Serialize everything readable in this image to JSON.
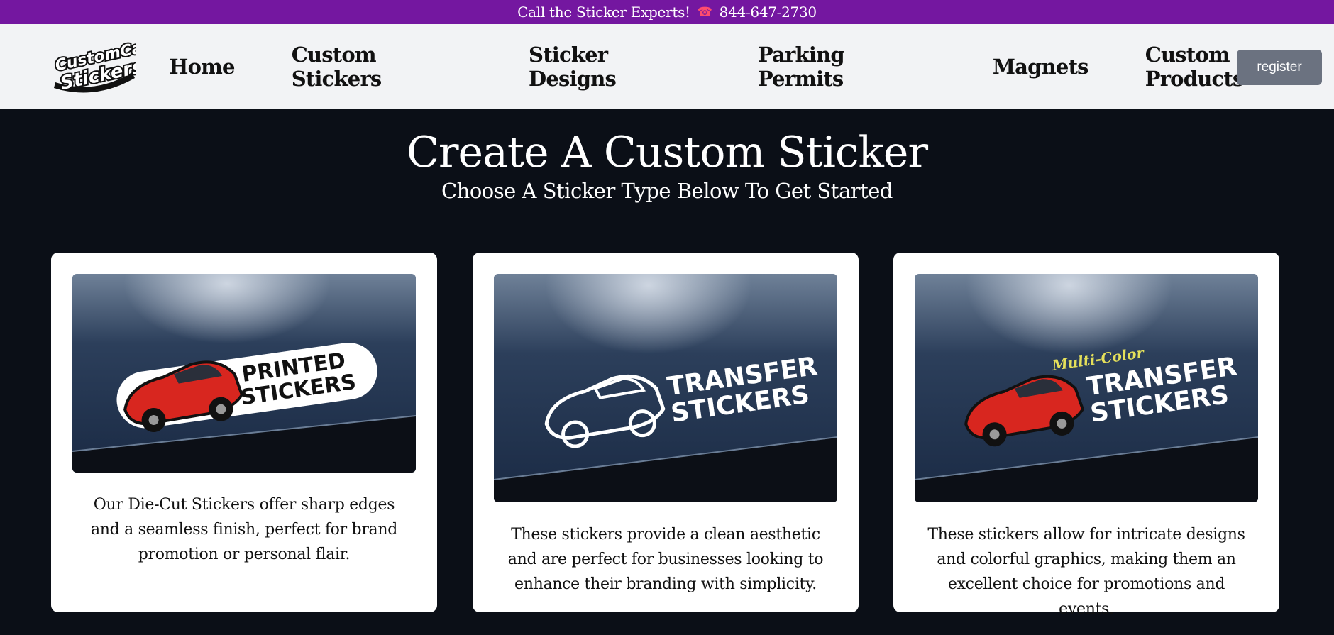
{
  "topbar": {
    "text": "Call the Sticker Experts!",
    "phone_icon": "telephone-icon",
    "phone": "844-647-2730"
  },
  "header": {
    "logo_line1": "CustomCar",
    "logo_line2": "Stickers",
    "nav": [
      {
        "label": "Home"
      },
      {
        "label": "Custom Stickers"
      },
      {
        "label": "Sticker Designs"
      },
      {
        "label": "Parking Permits"
      },
      {
        "label": "Magnets"
      },
      {
        "label": "Custom Products"
      }
    ],
    "register_label": "register"
  },
  "hero": {
    "title": "Create A Custom Sticker",
    "subtitle": "Choose A Sticker Type Below To Get Started"
  },
  "cards": [
    {
      "image_line1": "PRINTED",
      "image_line2": "STICKERS",
      "description": "Our Die-Cut Stickers offer sharp edges and a seamless finish, perfect for brand promotion or personal flair."
    },
    {
      "image_line1": "TRANSFER",
      "image_line2": "STICKERS",
      "description": "These stickers provide a clean aesthetic and are perfect for businesses looking to enhance their branding with simplicity."
    },
    {
      "image_tagline": "Multi-Color",
      "image_line1": "TRANSFER",
      "image_line2": "STICKERS",
      "description": "These stickers allow for intricate designs and colorful graphics, making them an excellent choice for promotions and events."
    }
  ],
  "colors": {
    "topbar": "#7417a0",
    "nav_bg": "#f2f3f5",
    "page_bg": "#0b0f17",
    "register": "#6b7280",
    "car_red": "#d8261f"
  }
}
